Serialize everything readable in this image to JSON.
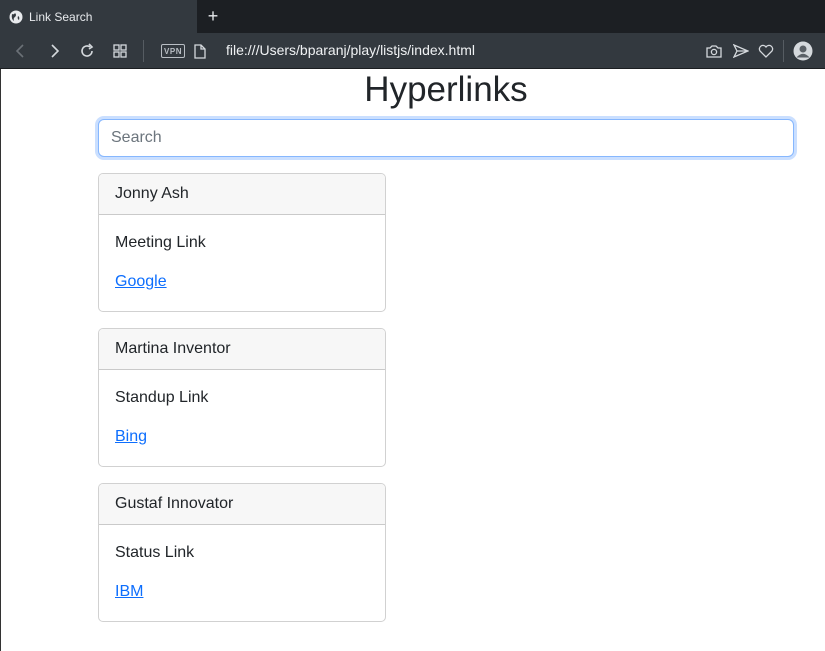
{
  "browser": {
    "tab_title": "Link Search",
    "new_tab": "+",
    "vpn_label": "VPN",
    "url": "file:///Users/bparanj/play/listjs/index.html"
  },
  "page": {
    "heading": "Hyperlinks",
    "search_placeholder": "Search",
    "cards": [
      {
        "name": "Jonny Ash",
        "label": "Meeting Link",
        "link_text": "Google"
      },
      {
        "name": "Martina Inventor",
        "label": "Standup Link",
        "link_text": "Bing"
      },
      {
        "name": "Gustaf Innovator",
        "label": "Status Link",
        "link_text": "IBM"
      }
    ]
  },
  "colors": {
    "chrome_dark": "#1c1f23",
    "chrome_toolbar": "#33393f",
    "link": "#0d6efd",
    "focus_border": "#86b7fe"
  }
}
